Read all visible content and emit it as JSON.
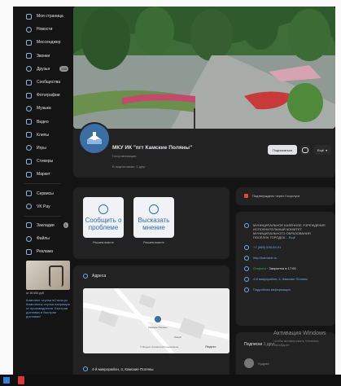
{
  "sidebar": {
    "items": [
      {
        "label": "Моя страница",
        "icon": "home-icon"
      },
      {
        "label": "Новости",
        "icon": "news-icon"
      },
      {
        "label": "Мессенджер",
        "icon": "messenger-icon"
      },
      {
        "label": "Звонки",
        "icon": "phone-icon"
      },
      {
        "label": "Друзья",
        "icon": "friends-icon",
        "badge": "239"
      },
      {
        "label": "Сообщества",
        "icon": "communities-icon"
      },
      {
        "label": "Фотографии",
        "icon": "photo-icon"
      },
      {
        "label": "Музыка",
        "icon": "music-icon"
      },
      {
        "label": "Видео",
        "icon": "video-icon"
      },
      {
        "label": "Клипы",
        "icon": "clips-icon"
      },
      {
        "label": "Игры",
        "icon": "games-icon"
      },
      {
        "label": "Стикеры",
        "icon": "stickers-icon"
      },
      {
        "label": "Маркет",
        "icon": "market-icon"
      }
    ],
    "items2": [
      {
        "label": "Сервисы",
        "icon": "services-icon"
      },
      {
        "label": "VK Pay",
        "icon": "vkpay-icon"
      }
    ],
    "items3": [
      {
        "label": "Закладки",
        "icon": "bookmark-icon",
        "badge": "1"
      },
      {
        "label": "Файлы",
        "icon": "files-icon"
      },
      {
        "label": "Реклама",
        "icon": "ads-icon"
      }
    ],
    "ad": {
      "caption": "от 26 000 руб",
      "text": "Комплект стулья вСтиль.рс Комплекты стулья напрямую от производителя. Быстрая доставка и быстрая доставка!"
    }
  },
  "profile": {
    "name": "МКУ ИК \"пгт Камские Поляны\"",
    "status": "Госорганизация",
    "friends": "В подписчиках: 1 друг",
    "subscribe_label": "Подписаться",
    "more_label": "Ещё"
  },
  "actions": [
    {
      "title": "Сообщить о проблеме",
      "caption": "Решаем вместе"
    },
    {
      "title": "Высказать мнение",
      "caption": "Решаем вместе"
    }
  ],
  "address": {
    "heading": "Адреса",
    "map_labels": [
      "Камские Поляны",
      "Лицей"
    ],
    "map_footer": "© Яндекс Условия использования",
    "yandex": "Яндекс",
    "line": "4-й микрорайон, 4, Камские Поляны"
  },
  "info": {
    "gosuslugi": "Подтверждено через Госуслуги",
    "description": "МУНИЦИПАЛЬНОЕ КАЗЁННОЕ УЧРЕЖДЕНИЕ ИСПОЛНИТЕЛЬНЫЙ КОМИТЕТ МУНИЦИПАЛЬНОГО ОБРАЗОВАНИЯ ПОСЁЛОК ГОРОДСК...",
    "more": "Ещё",
    "phone": "+7 (855) 535-09-91",
    "site": "http://kamskie.ru",
    "open_status": "Открыто",
    "open_time": "· Закроется в 17:00",
    "addr": "4-й микрорайон, 4, Камские Поляны",
    "details": "Подробная информация"
  },
  "subscriptions": {
    "title": "Подписки",
    "count": "1 друг",
    "person": "Худрия"
  },
  "watermark": {
    "title": "Активация Windows",
    "sub": "Чтобы активировать Windows, перейдите"
  },
  "colors": {
    "bg": "#141414",
    "card": "#222222",
    "accent": "#71aaeb",
    "text": "#e1e3e6"
  }
}
